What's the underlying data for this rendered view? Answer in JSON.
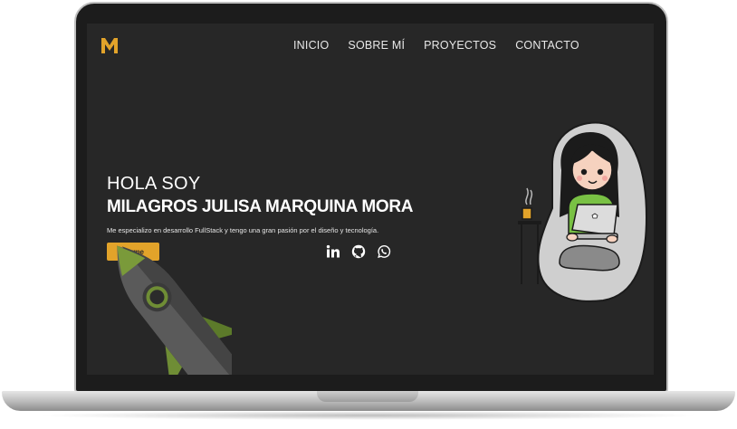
{
  "site": {
    "logo_letter": "M",
    "accent_color": "#e2a32a",
    "background_color": "#272727"
  },
  "nav": {
    "items": [
      {
        "label": "INICIO"
      },
      {
        "label": "SOBRE MÍ"
      },
      {
        "label": "PROYECTOS"
      },
      {
        "label": "CONTACTO"
      }
    ]
  },
  "hero": {
    "greeting": "HOLA SOY",
    "name": "MILAGROS JULISA MARQUINA MORA",
    "description": "Me especializo en desarrollo FullStack y tengo una gran pasión por el diseño y tecnología.",
    "button_label": "Verme"
  },
  "social": {
    "icons": [
      "linkedin-icon",
      "github-icon",
      "whatsapp-icon"
    ]
  },
  "illustrations": {
    "left": "rocket-illustration",
    "right": "girl-with-laptop-illustration"
  }
}
